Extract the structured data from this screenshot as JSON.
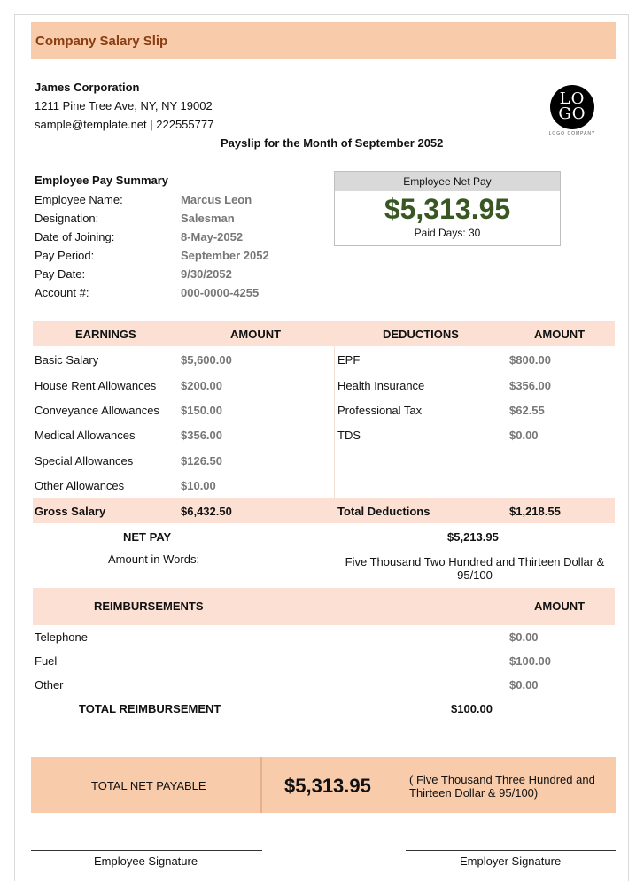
{
  "header": {
    "title": "Company Salary Slip"
  },
  "company": {
    "name": "James Corporation",
    "address": "1211 Pine Tree Ave, NY, NY 19002",
    "contact": "sample@template.net | 222555777",
    "logo_text_line1": "LO",
    "logo_text_line2": "GO",
    "logo_subtext": "LOGO COMPANY"
  },
  "payslip_title": "Payslip for the Month of September 2052",
  "summary": {
    "heading": "Employee Pay Summary",
    "fields": [
      {
        "label": "Employee Name:",
        "value": "Marcus Leon"
      },
      {
        "label": "Designation:",
        "value": "Salesman"
      },
      {
        "label": "Date of Joining:",
        "value": "8-May-2052"
      },
      {
        "label": "Pay Period:",
        "value": "September 2052"
      },
      {
        "label": "Pay Date:",
        "value": "9/30/2052"
      },
      {
        "label": "Account #:",
        "value": "000-0000-4255"
      }
    ]
  },
  "net_pay_box": {
    "heading": "Employee Net Pay",
    "amount": "$5,313.95",
    "paid_days": "Paid Days: 30"
  },
  "earnings": {
    "col_label": "EARNINGS",
    "col_amount": "AMOUNT",
    "rows": [
      {
        "label": "Basic Salary",
        "amount": "$5,600.00"
      },
      {
        "label": "House Rent Allowances",
        "amount": "$200.00"
      },
      {
        "label": "Conveyance Allowances",
        "amount": "$150.00"
      },
      {
        "label": "Medical Allowances",
        "amount": "$356.00"
      },
      {
        "label": "Special Allowances",
        "amount": "$126.50"
      },
      {
        "label": "Other Allowances",
        "amount": "$10.00"
      }
    ],
    "total_label": "Gross Salary",
    "total_amount": "$6,432.50"
  },
  "deductions": {
    "col_label": "DEDUCTIONS",
    "col_amount": "AMOUNT",
    "rows": [
      {
        "label": "EPF",
        "amount": "$800.00"
      },
      {
        "label": "Health Insurance",
        "amount": "$356.00"
      },
      {
        "label": "Professional Tax",
        "amount": "$62.55"
      },
      {
        "label": "TDS",
        "amount": "$0.00"
      }
    ],
    "total_label": "Total Deductions",
    "total_amount": "$1,218.55"
  },
  "net_pay": {
    "label": "NET PAY",
    "amount": "$5,213.95",
    "words_label": "Amount in Words:",
    "words_line1": "Five Thousand Two Hundred and Thirteen Dollar &",
    "words_line2": "95/100"
  },
  "reimbursements": {
    "col_label": "REIMBURSEMENTS",
    "col_amount": "AMOUNT",
    "rows": [
      {
        "label": "Telephone",
        "amount": "$0.00"
      },
      {
        "label": "Fuel",
        "amount": "$100.00"
      },
      {
        "label": "Other",
        "amount": "$0.00"
      }
    ],
    "total_label": "TOTAL REIMBURSEMENT",
    "total_amount": "$100.00"
  },
  "total_net_payable": {
    "label": "TOTAL NET PAYABLE",
    "amount": "$5,313.95",
    "words_line1": "( Five Thousand Three Hundred and",
    "words_line2": "Thirteen Dollar & 95/100)"
  },
  "signatures": {
    "employee": "Employee Signature",
    "employer": "Employer Signature"
  },
  "colors": {
    "title_bar": "#f8cbaa",
    "title_text": "#8a3d12",
    "table_header": "#fbe0d3",
    "net_pay_amount": "#385723",
    "muted_value": "#777777"
  }
}
